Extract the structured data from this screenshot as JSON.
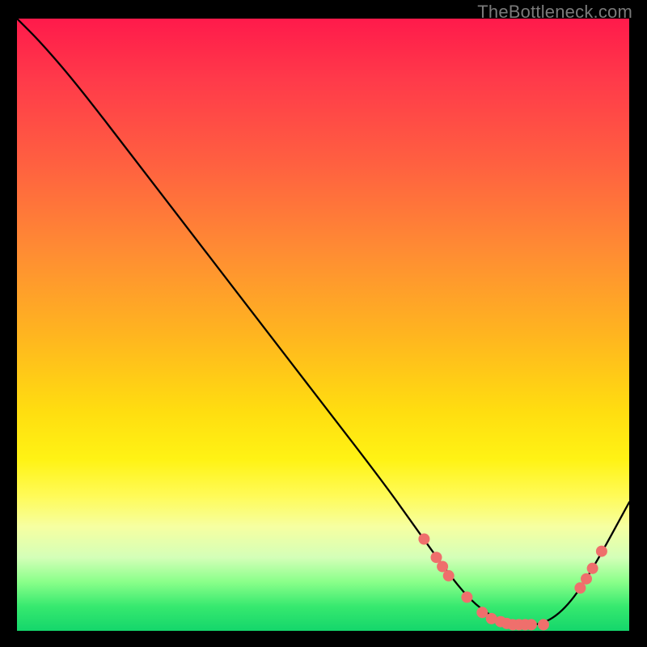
{
  "watermark": {
    "text": "TheBottleneck.com"
  },
  "colors": {
    "curve": "#000000",
    "marker_fill": "#ef6f6c",
    "marker_stroke": "#d45a58",
    "bg_black": "#000000"
  },
  "chart_data": {
    "type": "line",
    "title": "",
    "xlabel": "",
    "ylabel": "",
    "xlim": [
      0,
      100
    ],
    "ylim": [
      0,
      100
    ],
    "grid": false,
    "legend": false,
    "series": [
      {
        "name": "curve",
        "x": [
          0,
          4,
          10,
          20,
          30,
          40,
          50,
          60,
          65,
          70,
          74,
          78,
          82,
          86,
          90,
          94,
          100
        ],
        "y": [
          100,
          96,
          89,
          76,
          63,
          50,
          37,
          24,
          17,
          10,
          5,
          2,
          1,
          1,
          4,
          10,
          21
        ]
      }
    ],
    "markers": [
      {
        "x": 66.5,
        "y": 15.0
      },
      {
        "x": 68.5,
        "y": 12.0
      },
      {
        "x": 69.5,
        "y": 10.5
      },
      {
        "x": 70.5,
        "y": 9.0
      },
      {
        "x": 73.5,
        "y": 5.5
      },
      {
        "x": 76.0,
        "y": 3.0
      },
      {
        "x": 77.5,
        "y": 2.0
      },
      {
        "x": 79.0,
        "y": 1.5
      },
      {
        "x": 80.0,
        "y": 1.2
      },
      {
        "x": 81.0,
        "y": 1.0
      },
      {
        "x": 82.0,
        "y": 1.0
      },
      {
        "x": 83.0,
        "y": 1.0
      },
      {
        "x": 84.0,
        "y": 1.0
      },
      {
        "x": 86.0,
        "y": 1.0
      },
      {
        "x": 92.0,
        "y": 7.0
      },
      {
        "x": 93.0,
        "y": 8.5
      },
      {
        "x": 94.0,
        "y": 10.2
      },
      {
        "x": 95.5,
        "y": 13.0
      }
    ]
  }
}
